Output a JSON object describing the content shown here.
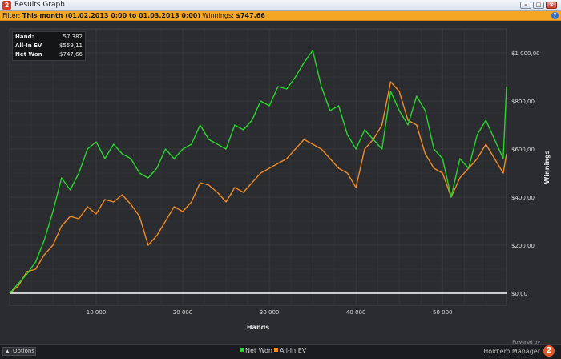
{
  "window": {
    "title": "Results Graph",
    "logo_char": "2",
    "min_symbol": "–",
    "max_symbol": "□",
    "close_symbol": "×"
  },
  "filter": {
    "prefix": "Filter:",
    "range": "This month (01.02.2013 0:00 to 01.03.2013 0:00)",
    "winnings_label": "Winnings:",
    "winnings_value": "$747,66",
    "help_char": "?"
  },
  "stats": {
    "hands_label": "Hand:",
    "hands_value": "57 382",
    "allin_label": "All-In EV",
    "allin_value": "$559,11",
    "netwon_label": "Net Won",
    "netwon_value": "$747,66"
  },
  "bottom": {
    "options_label": "Options",
    "options_arrow": "▲",
    "powered_by": "Powered by",
    "brand_name": "Hold'em Manager",
    "brand_logo": "2"
  },
  "colors": {
    "net_won": "#27d62a",
    "allin_ev": "#f08a24",
    "zero_line": "#ffffff",
    "grid": "#3b3c41",
    "plot_bg": "#2b2c30"
  },
  "chart_data": {
    "type": "line",
    "xlabel": "Hands",
    "ylabel": "Winnings",
    "xlim": [
      0,
      57382
    ],
    "ylim": [
      -50,
      1100
    ],
    "x_ticks": [
      10000,
      20000,
      30000,
      40000,
      50000
    ],
    "x_tick_labels": [
      "10 000",
      "20 000",
      "30 000",
      "40 000",
      "50 000"
    ],
    "y_ticks": [
      0,
      200,
      400,
      600,
      800,
      1000
    ],
    "y_tick_labels": [
      "$0,00",
      "$200,00",
      "$400,00",
      "$600,00",
      "$800,00",
      "$1 000,00"
    ],
    "grid": true,
    "legend_position": "bottom",
    "x": [
      0,
      1000,
      2000,
      3000,
      4000,
      5000,
      6000,
      7000,
      8000,
      9000,
      10000,
      11000,
      12000,
      13000,
      14000,
      15000,
      16000,
      17000,
      18000,
      19000,
      20000,
      21000,
      22000,
      23000,
      24000,
      25000,
      26000,
      27000,
      28000,
      29000,
      30000,
      31000,
      32000,
      33000,
      34000,
      35000,
      36000,
      37000,
      38000,
      39000,
      40000,
      41000,
      42000,
      43000,
      44000,
      45000,
      46000,
      47000,
      48000,
      49000,
      50000,
      51000,
      52000,
      53000,
      54000,
      55000,
      56000,
      57000,
      57382
    ],
    "series": [
      {
        "name": "Net Won",
        "color": "#27d62a",
        "values": [
          0,
          40,
          80,
          130,
          220,
          340,
          480,
          430,
          500,
          600,
          630,
          560,
          620,
          580,
          560,
          500,
          480,
          520,
          600,
          560,
          600,
          620,
          700,
          640,
          620,
          600,
          700,
          680,
          720,
          800,
          780,
          860,
          850,
          900,
          960,
          1010,
          860,
          760,
          780,
          660,
          600,
          680,
          640,
          600,
          840,
          760,
          700,
          820,
          760,
          600,
          560,
          400,
          560,
          520,
          660,
          720,
          640,
          560,
          860
        ]
      },
      {
        "name": "All-In EV",
        "color": "#f08a24",
        "values": [
          0,
          30,
          90,
          100,
          160,
          200,
          280,
          320,
          310,
          360,
          330,
          390,
          380,
          410,
          370,
          320,
          200,
          240,
          300,
          360,
          340,
          380,
          460,
          450,
          420,
          380,
          440,
          420,
          460,
          500,
          520,
          540,
          560,
          600,
          640,
          620,
          600,
          560,
          520,
          500,
          440,
          600,
          640,
          700,
          880,
          840,
          720,
          700,
          580,
          520,
          500,
          400,
          480,
          520,
          560,
          620,
          560,
          500,
          580
        ]
      }
    ]
  }
}
